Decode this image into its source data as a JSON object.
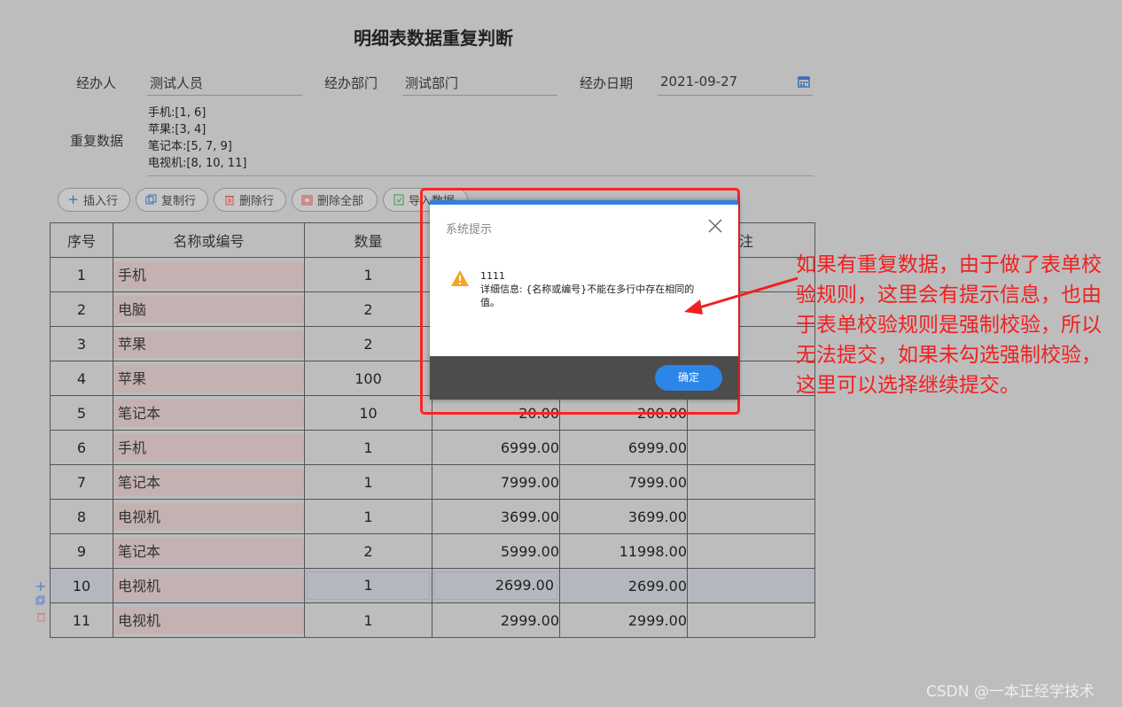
{
  "form": {
    "title": "明细表数据重复判断",
    "handler_label": "经办人",
    "handler_value": "测试人员",
    "dept_label": "经办部门",
    "dept_value": "测试部门",
    "date_label": "经办日期",
    "date_value": "2021-09-27",
    "dup_label": "重复数据",
    "dup_lines": [
      "手机:[1, 6]",
      "苹果:[3, 4]",
      "笔记本:[5, 7, 9]",
      "电视机:[8, 10, 11]"
    ]
  },
  "toolbar": {
    "insert": "插入行",
    "copy": "复制行",
    "delete": "删除行",
    "delete_all": "删除全部",
    "import": "导入数据"
  },
  "table": {
    "headers": [
      "序号",
      "名称或编号",
      "数量",
      "",
      "",
      "备注"
    ],
    "rows": [
      {
        "no": "1",
        "name": "手机",
        "qty": "1",
        "price": "",
        "total": "",
        "note": ""
      },
      {
        "no": "2",
        "name": "电脑",
        "qty": "2",
        "price": "",
        "total": "",
        "note": ""
      },
      {
        "no": "3",
        "name": "苹果",
        "qty": "2",
        "price": "",
        "total": "",
        "note": ""
      },
      {
        "no": "4",
        "name": "苹果",
        "qty": "100",
        "price": "",
        "total": "",
        "note": ""
      },
      {
        "no": "5",
        "name": "笔记本",
        "qty": "10",
        "price": "20.00",
        "total": "200.00",
        "note": ""
      },
      {
        "no": "6",
        "name": "手机",
        "qty": "1",
        "price": "6999.00",
        "total": "6999.00",
        "note": ""
      },
      {
        "no": "7",
        "name": "笔记本",
        "qty": "1",
        "price": "7999.00",
        "total": "7999.00",
        "note": ""
      },
      {
        "no": "8",
        "name": "电视机",
        "qty": "1",
        "price": "3699.00",
        "total": "3699.00",
        "note": ""
      },
      {
        "no": "9",
        "name": "笔记本",
        "qty": "2",
        "price": "5999.00",
        "total": "11998.00",
        "note": ""
      },
      {
        "no": "10",
        "name": "电视机",
        "qty": "1",
        "price": "2699.00",
        "total": "2699.00",
        "note": ""
      },
      {
        "no": "11",
        "name": "电视机",
        "qty": "1",
        "price": "2999.00",
        "total": "2999.00",
        "note": ""
      }
    ]
  },
  "dialog": {
    "title": "系统提示",
    "code": "1111",
    "message": "详细信息: {名称或编号}不能在多行中存在相同的值。",
    "ok_label": "确定"
  },
  "annotation": "如果有重复数据，由于做了表单校验规则，这里会有提示信息，也由于表单校验规则是强制校验，所以无法提交，如果未勾选强制校验，这里可以选择继续提交。",
  "watermark": "CSDN @一本正经学技术",
  "colors": {
    "accent": "#2b86e8",
    "annotation_red": "#f21f1f",
    "warning": "#f5a623"
  }
}
